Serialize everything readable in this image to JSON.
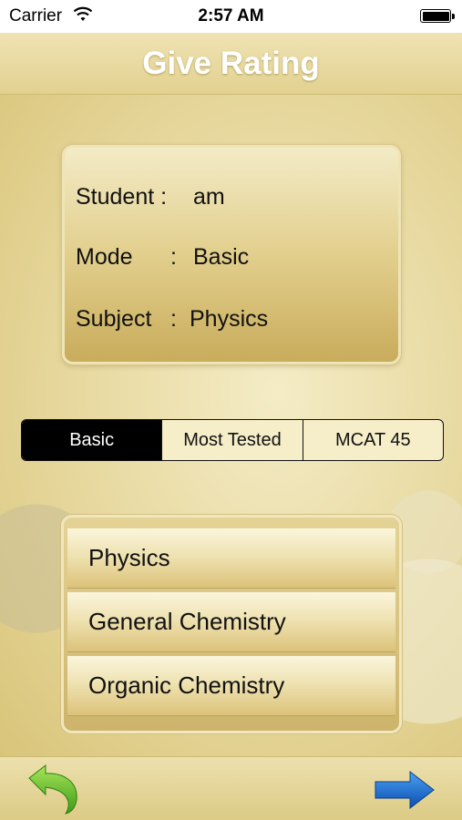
{
  "status_bar": {
    "carrier": "Carrier",
    "time": "2:57 AM"
  },
  "header": {
    "title": "Give Rating"
  },
  "info": {
    "student_label": "Student :",
    "student_value": "am",
    "mode_label": "Mode",
    "mode_colon": ":",
    "mode_value": "Basic",
    "subject_label": "Subject",
    "subject_colon": ":",
    "subject_value": "Physics"
  },
  "segments": [
    {
      "label": "Basic",
      "selected": true
    },
    {
      "label": "Most Tested",
      "selected": false
    },
    {
      "label": "MCAT 45",
      "selected": false
    }
  ],
  "subjects": [
    {
      "label": "Physics"
    },
    {
      "label": "General Chemistry"
    },
    {
      "label": "Organic Chemistry"
    }
  ],
  "toolbar": {
    "back_icon": "back-arrow-icon",
    "next_icon": "next-arrow-icon"
  },
  "colors": {
    "background": "#e9dca0",
    "segment_active": "#000000",
    "back_arrow": "#6fc32b",
    "next_arrow": "#1f6fd1"
  }
}
